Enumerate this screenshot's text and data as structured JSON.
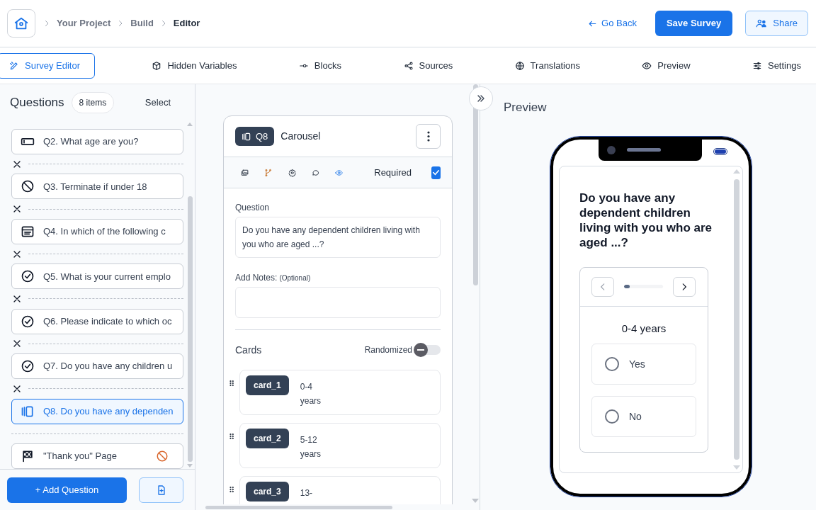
{
  "breadcrumb": [
    {
      "label": "Your Project",
      "current": false
    },
    {
      "label": "Build",
      "current": false
    },
    {
      "label": "Editor",
      "current": true
    }
  ],
  "header_actions": {
    "go_back": "Go Back",
    "save": "Save Survey",
    "share": "Share"
  },
  "tabs": [
    {
      "label": "Survey Editor",
      "selected": true
    },
    {
      "label": "Hidden Variables",
      "selected": false
    },
    {
      "label": "Blocks",
      "selected": false
    },
    {
      "label": "Sources",
      "selected": false
    },
    {
      "label": "Translations",
      "selected": false
    },
    {
      "label": "Preview",
      "selected": false
    },
    {
      "label": "Settings",
      "selected": false
    }
  ],
  "questions_panel": {
    "title": "Questions",
    "count": "8 items",
    "select": "Select",
    "add_button": "+ Add Question",
    "items": [
      {
        "kind": "input",
        "label": "Q2. What age are you?",
        "selected": false
      },
      {
        "kind": "terminate",
        "label": "Q3. Terminate if under 18",
        "selected": false
      },
      {
        "kind": "form",
        "label": "Q4. In which of the following c",
        "selected": false
      },
      {
        "kind": "single",
        "label": "Q5. What is your current emplo",
        "selected": false
      },
      {
        "kind": "single",
        "label": "Q6. Please indicate to which oc",
        "selected": false
      },
      {
        "kind": "single",
        "label": "Q7. Do you have any children u",
        "selected": false
      },
      {
        "kind": "carousel",
        "label": "Q8. Do you have any dependen",
        "selected": true
      },
      {
        "kind": "end",
        "label": "\"Thank you\" Page",
        "selected": false
      }
    ]
  },
  "editor": {
    "badge": "Q8",
    "type": "Carousel",
    "required_label": "Required",
    "required": true,
    "question_label": "Question",
    "question_text": "Do you have any dependent children living with you who are aged ...?",
    "notes_label": "Add Notes:",
    "notes_hint": "(Optional)",
    "cards_label": "Cards",
    "randomized_label": "Randomized",
    "randomized": false,
    "cards": [
      {
        "tag": "card_1",
        "text": "0-4 years"
      },
      {
        "tag": "card_2",
        "text": "5-12 years"
      },
      {
        "tag": "card_3",
        "text": "13-"
      }
    ]
  },
  "preview": {
    "title": "Preview",
    "question": "Do you have any dependent children living with you who are aged ...?",
    "carousel": {
      "level": 0.15,
      "card_title": "0-4 years",
      "options": [
        {
          "label": "Yes",
          "selected": false
        },
        {
          "label": "No",
          "selected": false
        }
      ]
    }
  }
}
